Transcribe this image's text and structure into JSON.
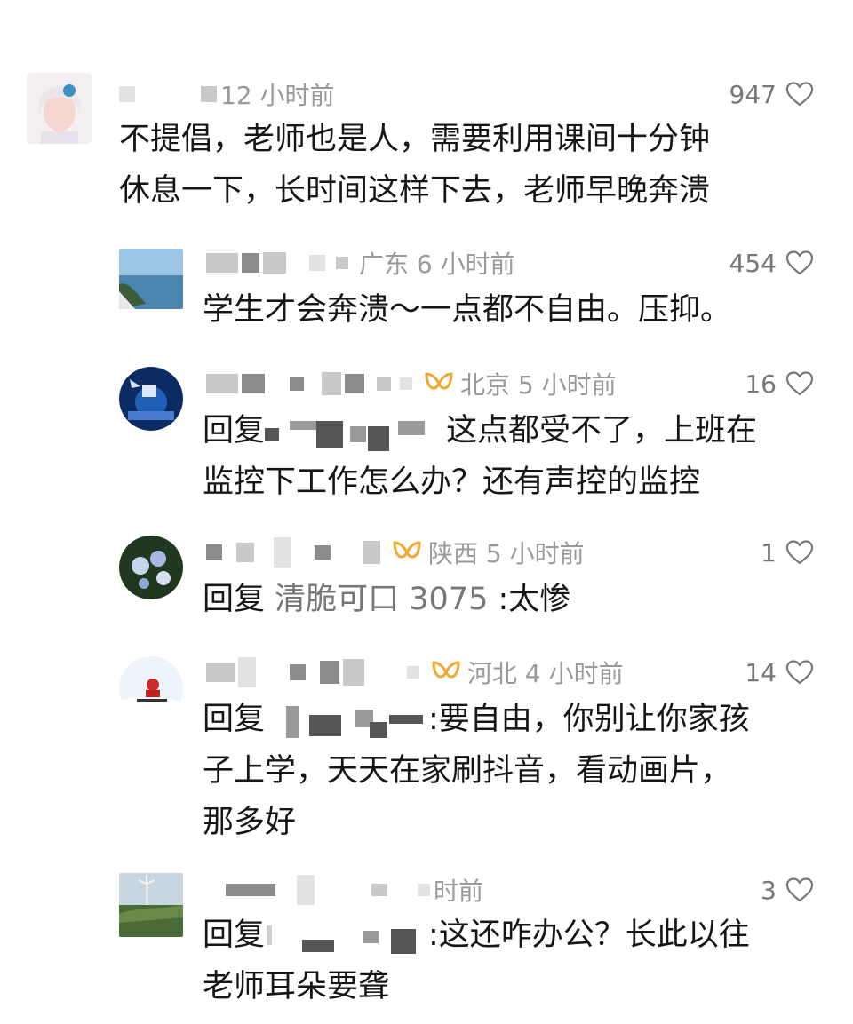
{
  "colors": {
    "text": "#161616",
    "meta": "#9a9a9a",
    "badge": "#f0a830",
    "heart": "#777777"
  },
  "comments": [
    {
      "time": "12 小时前",
      "likes": "947",
      "text_lines": [
        "不提倡，老师也是人，需要利用课间十分钟",
        "休息一下，长时间这样下去，老师早晚奔溃"
      ]
    },
    {
      "location": "广东",
      "time": "6 小时前",
      "likes": "454",
      "text_lines": [
        "学生才会奔溃～一点都不自由。压抑。"
      ]
    },
    {
      "location": "北京",
      "time": "5 小时前",
      "likes": "16",
      "reply_prefix": "回复",
      "text_first": "这点都受不了，上班在",
      "text_lines": [
        "监控下工作怎么办？还有声控的监控"
      ]
    },
    {
      "location": "陕西",
      "time": "5 小时前",
      "likes": "1",
      "reply_prefix": "回复",
      "reply_target": "清脆可口 3075",
      "text_first": ":太惨"
    },
    {
      "location": "河北",
      "time": "4 小时前",
      "likes": "14",
      "reply_prefix": "回复",
      "text_first": ":要自由，你别让你家孩",
      "text_lines": [
        "子上学，天天在家刷抖音，看动画片，",
        "那多好"
      ]
    },
    {
      "time": "时前",
      "likes": "3",
      "reply_prefix": "回复",
      "text_first": ":这还咋办公？长此以往",
      "text_lines": [
        "老师耳朵要聋"
      ]
    }
  ]
}
